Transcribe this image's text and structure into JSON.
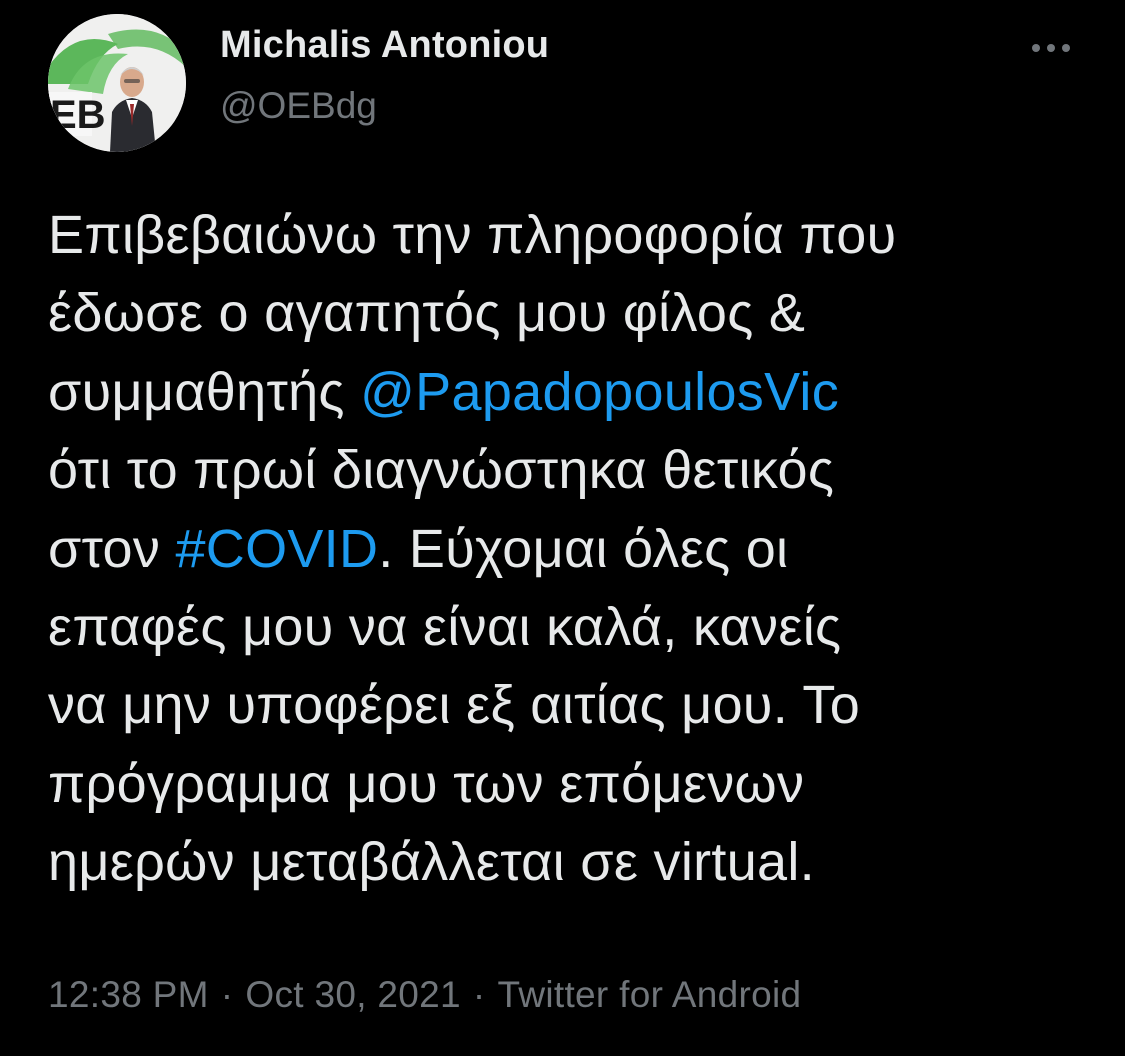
{
  "author": {
    "name": "Michalis Antoniou",
    "handle": "@OEBdg",
    "avatar_logo_text": "EB"
  },
  "more_icon": "more-horizontal-icon",
  "tweet": {
    "lines": [
      [
        {
          "text": "Επιβεβαιώνω την πληροφορία που"
        }
      ],
      [
        {
          "text": "έδωσε ο αγαπητός μου φίλος &"
        }
      ],
      [
        {
          "text": "συμμαθητής "
        },
        {
          "text": "@PapadopoulosVic",
          "link": true
        }
      ],
      [
        {
          "text": "ότι το πρωί διαγνώστηκα θετικός"
        }
      ],
      [
        {
          "text": "στον "
        },
        {
          "text": "#COVID",
          "link": true
        },
        {
          "text": ". Εύχομαι όλες οι"
        }
      ],
      [
        {
          "text": "επαφές μου να είναι καλά, κανείς"
        }
      ],
      [
        {
          "text": "να μην υποφέρει εξ αιτίας μου. Το"
        }
      ],
      [
        {
          "text": "πρόγραμμα μου των επόμενων"
        }
      ],
      [
        {
          "text": "ημερών μεταβάλλεται σε virtual."
        }
      ]
    ]
  },
  "meta": {
    "time": "12:38 PM",
    "date": "Oct 30, 2021",
    "separator": "·",
    "source": "Twitter for Android"
  },
  "colors": {
    "background": "#000000",
    "text": "#e7e9ea",
    "secondary": "#71767b",
    "link": "#1d9bf0"
  }
}
